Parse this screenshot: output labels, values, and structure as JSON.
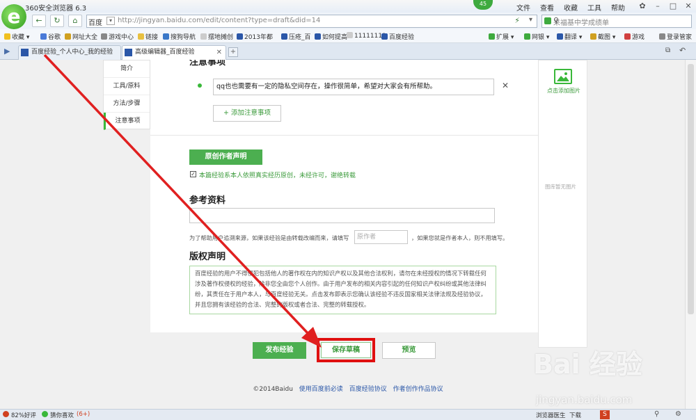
{
  "browser": {
    "title": "360安全浏览器 6.3",
    "menus": [
      "文件",
      "查看",
      "收藏",
      "工具",
      "帮助"
    ],
    "notification_count": "45",
    "address": {
      "engine": "百度",
      "url": "http://jingyan.baidu.com/edit/content?type=draft&did=14"
    },
    "search_placeholder": "来福基中学成绩单",
    "bookmarks": [
      "收藏",
      "谷歌",
      "网址大全",
      "游戏中心",
      "链接",
      "搜狗导航",
      "摆地摊创",
      "2013年都",
      "压疮_百",
      "如何提高",
      "11111111",
      "百度经验"
    ],
    "toolbar_right": [
      "扩展",
      "网银",
      "翻译",
      "截图",
      "游戏",
      "登录管家"
    ],
    "tabs": [
      {
        "label": "百度经验_个人中心_我的经验"
      },
      {
        "label": "高级编辑器_百度经验"
      }
    ]
  },
  "sidenav": [
    "简介",
    "工具/原料",
    "方法/步骤",
    "注意事项"
  ],
  "editor": {
    "notes_heading": "注意事项",
    "note_text": "qq也也需要有一定的隐私空间存在，操作很简单，希望对大家会有所帮助。",
    "add_note_label": "+ 添加注意事项",
    "original_label": "原创作者声明",
    "original_checkbox": "本篇经验系本人依照真实经历原创，未经许可，谢绝转载",
    "reference_heading": "参考资料",
    "author_hint": "为了帮助用户追溯来源，如果该经验是由转载改编而来，请填写",
    "author_placeholder": "原作者",
    "author_hint_2": "，如果您就是作者本人，则不用填写。",
    "copyright_heading": "版权声明",
    "copyright_text": "百度经验的用户不得侵犯包括他人的著作权在内的知识产权以及其他合法权利，请勿在未经授权的情况下转载任何涉及著作权侵权的经验，除非您全由您个人创作。由于用户发布的相关内容引起的任何知识产权纠纷或其他法律纠纷，其责任在于用户本人，与百度经验无关。点击发布即表示您确认该经验不违反国家相关法律法规及经验协议，并且您拥有该经验的合法、完整的版权或者合法、完整的转载授权。"
  },
  "actions": {
    "publish": "发布经验",
    "save_draft": "保存草稿",
    "preview": "预览"
  },
  "right_panel": {
    "add_image": "点击添加图片",
    "no_image": "图库暂无图片"
  },
  "footer": {
    "copyright": "©2014Baidu",
    "links": [
      "使用百度前必读",
      "百度经验协议",
      "作者创作作品协议"
    ]
  },
  "statusbar": {
    "rating": "82%好评",
    "guess": "猜你喜欢",
    "guess_count": "(6+)",
    "doctor": "浏览器医生",
    "download": "下载"
  },
  "watermark": {
    "brand": "Bai 经验",
    "url": "jingyan.baidu.com"
  },
  "colors": {
    "accent_green": "#4caf50",
    "highlight_red": "#e01010",
    "arrow_red": "#e02020"
  }
}
